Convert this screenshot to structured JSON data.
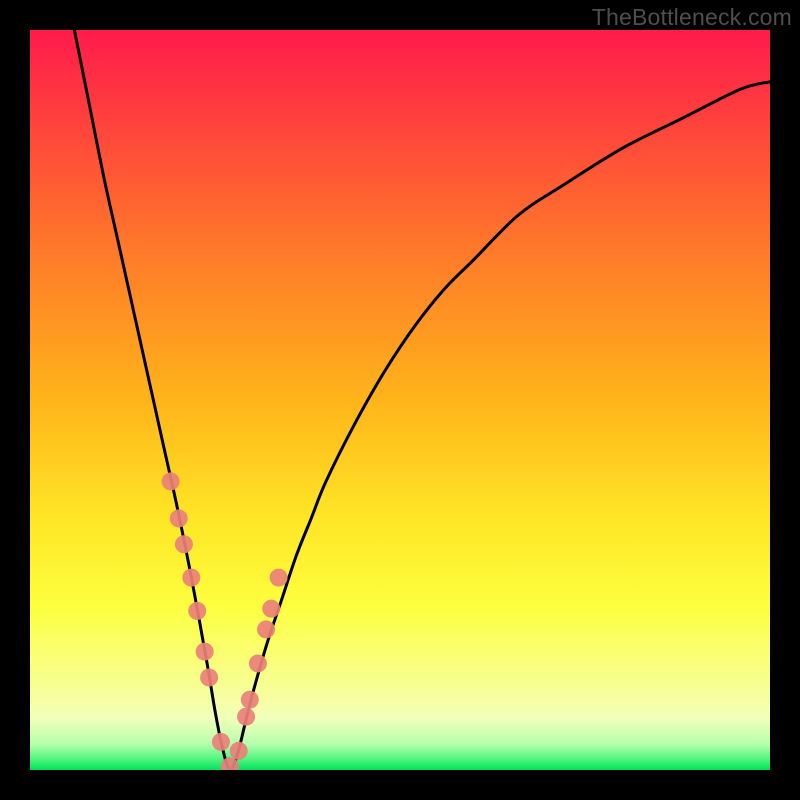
{
  "watermark": "TheBottleneck.com",
  "colors": {
    "frame": "#000000",
    "gradient_top": "#ff1b4b",
    "gradient_mid": "#ffc400",
    "gradient_yellow": "#fdff3f",
    "gradient_pale": "#f1ffb9",
    "gradient_green": "#00e25d",
    "curve": "#000000",
    "marker_fill": "#ea8079",
    "marker_stroke": "#ea8079"
  },
  "chart_data": {
    "type": "line",
    "title": "",
    "xlabel": "",
    "ylabel": "",
    "xlim": [
      0,
      100
    ],
    "ylim": [
      0,
      100
    ],
    "x_at_minimum": 27,
    "series": [
      {
        "name": "bottleneck-curve",
        "x": [
          6,
          8,
          10,
          12,
          14,
          16,
          18,
          20,
          22,
          24,
          25,
          26,
          27,
          28,
          29,
          30,
          32,
          34,
          36,
          38,
          40,
          44,
          48,
          52,
          56,
          60,
          66,
          72,
          80,
          88,
          96,
          100
        ],
        "y": [
          100,
          90,
          80,
          71,
          62,
          53,
          44,
          35,
          25,
          14,
          8,
          3,
          0,
          2,
          6,
          10,
          17,
          23,
          29,
          34,
          39,
          47,
          54,
          60,
          65,
          69,
          75,
          79,
          84,
          88,
          92,
          93
        ]
      }
    ],
    "markers": {
      "name": "sample-points",
      "x": [
        19.0,
        20.1,
        20.8,
        21.8,
        22.6,
        23.6,
        24.2,
        25.8,
        27.0,
        28.2,
        29.2,
        29.7,
        30.8,
        31.9,
        32.6,
        33.6
      ],
      "y": [
        39.0,
        34.0,
        30.5,
        26.0,
        21.5,
        16.0,
        12.5,
        3.8,
        0.5,
        2.6,
        7.2,
        9.5,
        14.4,
        19.0,
        21.8,
        26.0
      ]
    }
  }
}
